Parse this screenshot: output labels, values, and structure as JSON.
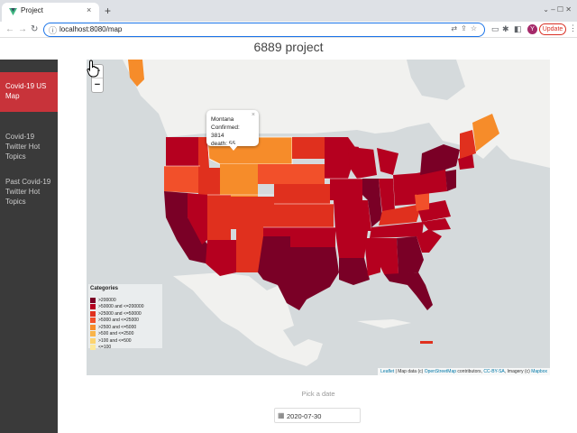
{
  "browser": {
    "tab_title": "Project",
    "tab_close": "×",
    "new_tab": "+",
    "url": "localhost:8080/map",
    "avatar_letter": "Y",
    "update_label": "Update",
    "win_controls": "⌄  –  ☐  ✕"
  },
  "header": {
    "title": "6889 project"
  },
  "sidebar": {
    "items": [
      {
        "label": "Covid-19 US Map",
        "active": true
      },
      {
        "label": "Covid-19 Twitter Hot Topics",
        "active": false
      },
      {
        "label": "Past Covid-19 Twitter Hot Topics",
        "active": false
      }
    ]
  },
  "map": {
    "zoom_in": "+",
    "zoom_out": "−",
    "popup": {
      "state": "Montana",
      "confirmed": "Confirmed: 3814",
      "death": "death: 55",
      "close": "×"
    },
    "legend": {
      "title": "Categories",
      "items": [
        {
          "label": ">200000",
          "color": "#7a0026"
        },
        {
          "label": ">50000 and <=200000",
          "color": "#b5001f"
        },
        {
          "label": ">25000 and <=50000",
          "color": "#e0301e"
        },
        {
          "label": ">5000 and <=25000",
          "color": "#f2502a"
        },
        {
          "label": ">2500 and <=5000",
          "color": "#f68c2a"
        },
        {
          "label": ">500 and <=2500",
          "color": "#f9b44a"
        },
        {
          "label": ">100 and <=500",
          "color": "#fcd36e"
        },
        {
          "label": "<=100",
          "color": "#fde89a"
        }
      ]
    },
    "attribution": {
      "leaflet": "Leaflet",
      "map_data": "| Map data (c)",
      "osm": "OpenStreetMap",
      "contributors": "contributors,",
      "license": "CC-BY-SA",
      "imagery": ", Imagery (c)",
      "mapbox": "Mapbox"
    },
    "state_colors": {
      "darkest": "#7a0026",
      "dark": "#b5001f",
      "red": "#d7191c",
      "orange_red": "#f2502a",
      "orange": "#f68c2a",
      "land": "#f2efe9",
      "water": "#aad3df"
    }
  },
  "date_picker": {
    "title": "Pick a date",
    "value": "2020-07-30",
    "calendar_icon": "calendar-icon"
  }
}
